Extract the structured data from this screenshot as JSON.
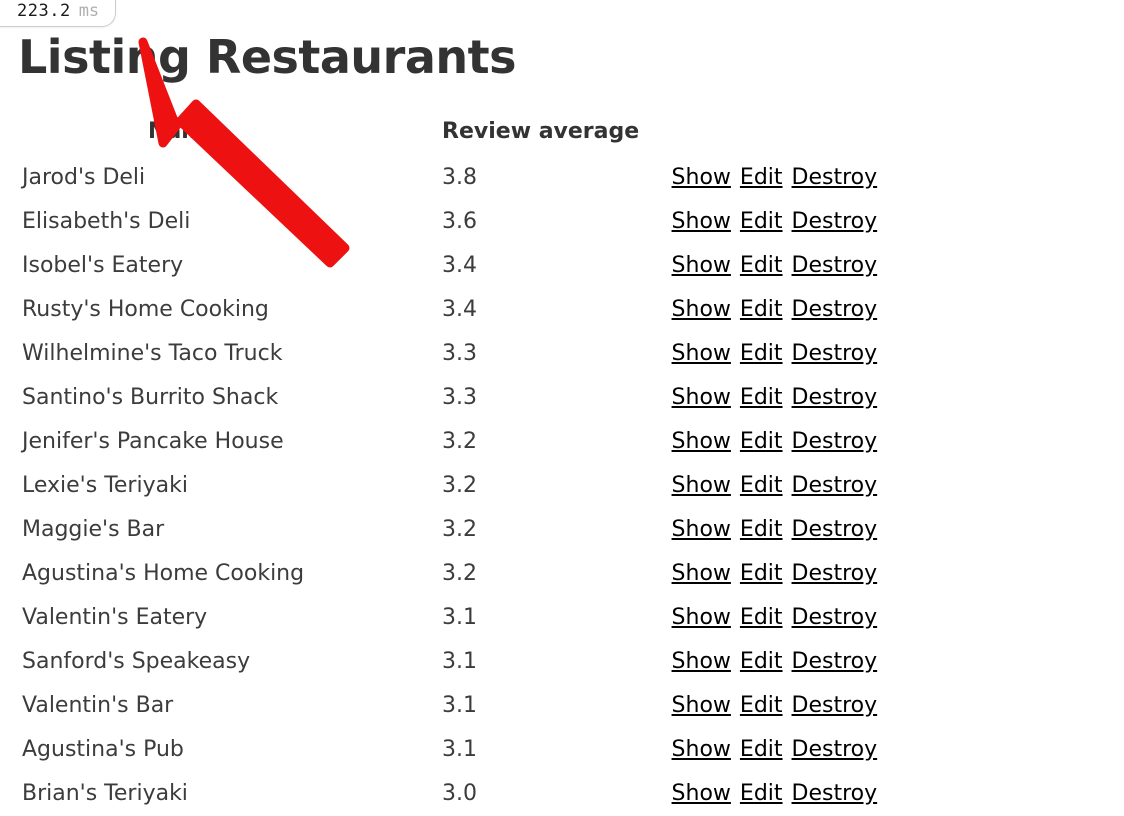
{
  "perf_badge": {
    "value": "223.2",
    "unit": "ms"
  },
  "page": {
    "title": "Listing Restaurants"
  },
  "table": {
    "headers": {
      "name": "Name",
      "review_average": "Review average"
    },
    "actions": {
      "show": "Show",
      "edit": "Edit",
      "destroy": "Destroy"
    },
    "rows": [
      {
        "name": "Jarod's Deli",
        "review_average": "3.8"
      },
      {
        "name": "Elisabeth's Deli",
        "review_average": "3.6"
      },
      {
        "name": "Isobel's Eatery",
        "review_average": "3.4"
      },
      {
        "name": "Rusty's Home Cooking",
        "review_average": "3.4"
      },
      {
        "name": "Wilhelmine's Taco Truck",
        "review_average": "3.3"
      },
      {
        "name": "Santino's Burrito Shack",
        "review_average": "3.3"
      },
      {
        "name": "Jenifer's Pancake House",
        "review_average": "3.2"
      },
      {
        "name": "Lexie's Teriyaki",
        "review_average": "3.2"
      },
      {
        "name": "Maggie's Bar",
        "review_average": "3.2"
      },
      {
        "name": "Agustina's Home Cooking",
        "review_average": "3.2"
      },
      {
        "name": "Valentin's Eatery",
        "review_average": "3.1"
      },
      {
        "name": "Sanford's Speakeasy",
        "review_average": "3.1"
      },
      {
        "name": "Valentin's Bar",
        "review_average": "3.1"
      },
      {
        "name": "Agustina's Pub",
        "review_average": "3.1"
      },
      {
        "name": "Brian's Teriyaki",
        "review_average": "3.0"
      }
    ]
  },
  "colors": {
    "title": "#333333",
    "text": "#3c3c3c",
    "link": "#000000",
    "pointer": "#ee1111",
    "badge_border": "#cccccc",
    "badge_unit": "#b0b0b0"
  }
}
